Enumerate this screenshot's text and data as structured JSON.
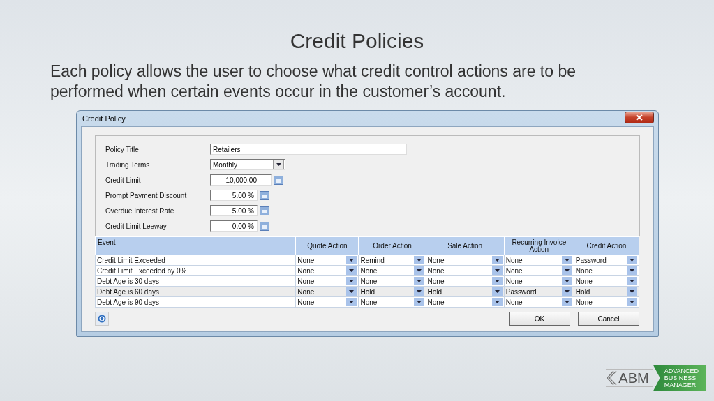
{
  "slide": {
    "title": "Credit Policies",
    "text": "Each policy allows the user to choose what credit control actions are to be performed when certain events occur in the customer’s account."
  },
  "window": {
    "title": "Credit Policy"
  },
  "form": [
    {
      "label": "Policy Title",
      "kind": "text",
      "value": "Retailers"
    },
    {
      "label": "Trading Terms",
      "kind": "dropdown",
      "value": "Monthly"
    },
    {
      "label": "Credit Limit",
      "kind": "amount",
      "value": "10,000.00"
    },
    {
      "label": "Prompt Payment Discount",
      "kind": "percent",
      "value": "5.00 %"
    },
    {
      "label": "Overdue Interest Rate",
      "kind": "percent",
      "value": "5.00 %"
    },
    {
      "label": "Credit Limit Leeway",
      "kind": "percent",
      "value": "0.00 %"
    }
  ],
  "table": {
    "columns": [
      "Event",
      "Quote Action",
      "Order Action",
      "Sale Action",
      "Recurring Invoice Action",
      "Credit Action"
    ],
    "rows": [
      {
        "event": "Credit Limit Exceeded",
        "selected": false,
        "actions": [
          "None",
          "Remind",
          "None",
          "None",
          "Password"
        ]
      },
      {
        "event": "Credit Limit Exceeded by 0%",
        "selected": false,
        "actions": [
          "None",
          "None",
          "None",
          "None",
          "None"
        ]
      },
      {
        "event": "Debt Age is 30 days",
        "selected": false,
        "actions": [
          "None",
          "None",
          "None",
          "None",
          "None"
        ]
      },
      {
        "event": "Debt Age is 60 days",
        "selected": true,
        "actions": [
          "None",
          "Hold",
          "Hold",
          "Password",
          "Hold"
        ]
      },
      {
        "event": "Debt Age is 90 days",
        "selected": false,
        "actions": [
          "None",
          "None",
          "None",
          "None",
          "None"
        ]
      }
    ]
  },
  "buttons": [
    "OK",
    "Cancel"
  ],
  "logo": {
    "mark": "ABM",
    "lines": [
      "ADVANCED",
      "BUSINESS",
      "MANAGER"
    ]
  }
}
